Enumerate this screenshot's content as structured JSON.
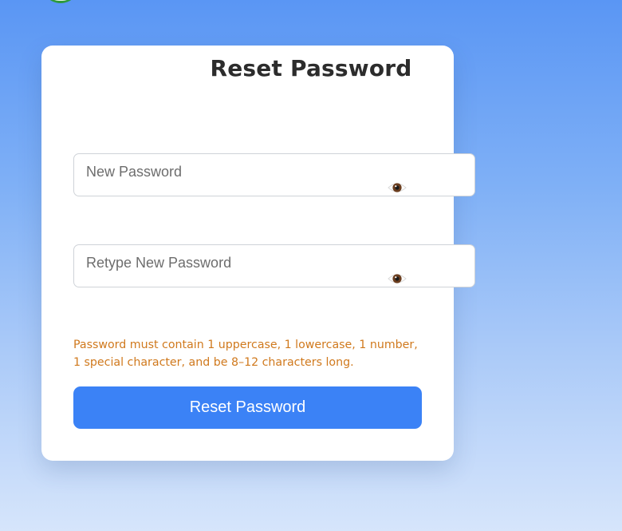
{
  "reset_form": {
    "title": "Reset Password",
    "new_password": {
      "placeholder": "New Password",
      "value": "",
      "toggle_icon": "eye-icon"
    },
    "retype_password": {
      "placeholder": "Retype New Password",
      "value": "",
      "toggle_icon": "eye-icon"
    },
    "requirements_hint": "Password must contain 1 uppercase, 1 lowercase, 1 number, 1 special character, and be 8–12 characters long.",
    "submit_label": "Reset Password"
  },
  "colors": {
    "background_top": "#5a96f4",
    "background_bottom": "#d6e5fb",
    "primary_button": "#3b82f6",
    "hint_text": "#d0791d",
    "title_text": "#2c2c2c"
  }
}
